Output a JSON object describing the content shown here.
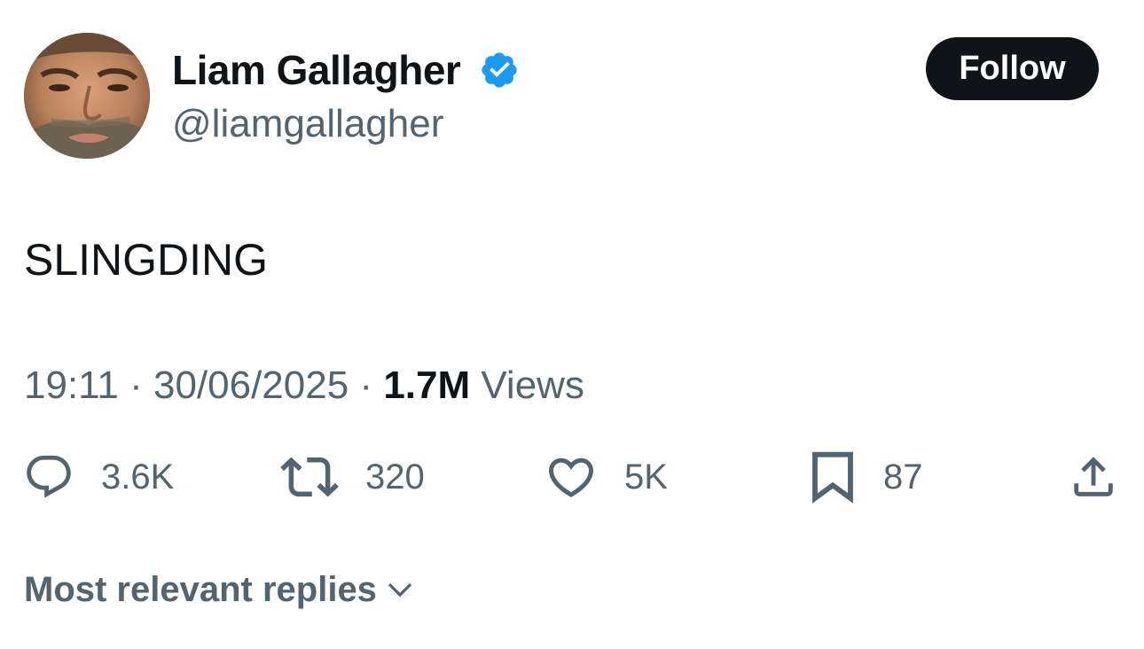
{
  "author": {
    "display_name": "Liam Gallagher",
    "handle": "@liamgallagher",
    "verified": true,
    "avatar_icon": "avatar-photo"
  },
  "follow_button": {
    "label": "Follow"
  },
  "tweet": {
    "text": "SLINGDING",
    "time": "19:11",
    "date": "30/06/2025",
    "separator": "·",
    "views_count": "1.7M",
    "views_label": "Views"
  },
  "actions": {
    "reply": {
      "icon": "reply-icon",
      "count": "3.6K"
    },
    "repost": {
      "icon": "repost-icon",
      "count": "320"
    },
    "like": {
      "icon": "heart-icon",
      "count": "5K"
    },
    "bookmark": {
      "icon": "bookmark-icon",
      "count": "87"
    },
    "share": {
      "icon": "share-icon"
    }
  },
  "replies_sort": {
    "label": "Most relevant replies",
    "icon": "chevron-down-icon"
  },
  "colors": {
    "text_primary": "#0f1419",
    "text_secondary": "#536471",
    "verified_blue": "#1d9bf0",
    "button_bg": "#0f1419",
    "background": "#ffffff"
  }
}
